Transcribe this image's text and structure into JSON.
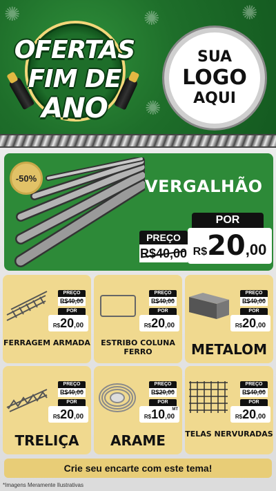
{
  "header": {
    "badge_title_line1": "OFERTAS",
    "badge_title_line2": "FIM DE",
    "badge_title_line3": "ANO",
    "logo_line1": "SUA",
    "logo_line2": "LOGO",
    "logo_line3": "AQUI"
  },
  "main_product": {
    "discount": "-50%",
    "name": "VERGALHÃO",
    "por_label": "POR",
    "preco_label": "PREÇO",
    "old_price": "R$40,00",
    "currency": "R$",
    "price_int": "20",
    "price_dec": ",00"
  },
  "cards": [
    {
      "name": "FERRAGEM ARMADA",
      "preco_label": "PREÇO",
      "old_price": "R$40,00",
      "por_label": "POR",
      "currency": "R$",
      "price_int": "20",
      "price_dec": ",00",
      "unit": ""
    },
    {
      "name": "ESTRIBO COLUNA FERRO",
      "preco_label": "PREÇO",
      "old_price": "R$40,00",
      "por_label": "POR",
      "currency": "R$",
      "price_int": "20",
      "price_dec": ",00",
      "unit": ""
    },
    {
      "name": "METALOM",
      "preco_label": "PREÇO",
      "old_price": "R$40,00",
      "por_label": "POR",
      "currency": "R$",
      "price_int": "20",
      "price_dec": ",00",
      "unit": ""
    },
    {
      "name": "TRELIÇA",
      "preco_label": "PREÇO",
      "old_price": "R$40,00",
      "por_label": "POR",
      "currency": "R$",
      "price_int": "20",
      "price_dec": ",00",
      "unit": ""
    },
    {
      "name": "ARAME",
      "preco_label": "PREÇO",
      "old_price": "R$20,00",
      "por_label": "POR",
      "currency": "R$",
      "price_int": "10",
      "price_dec": ",00",
      "unit": "MT"
    },
    {
      "name": "TELAS NERVURADAS",
      "preco_label": "PREÇO",
      "old_price": "R$40,00",
      "por_label": "POR",
      "currency": "R$",
      "price_int": "20",
      "price_dec": ",00",
      "unit": ""
    }
  ],
  "footer": {
    "cta": "Crie seu encarte com este tema!",
    "disclaimer": "*Imagens Meramente Ilustrativas"
  },
  "colors": {
    "green": "#2d8a38",
    "gold": "#f0d98f",
    "black": "#111111"
  }
}
